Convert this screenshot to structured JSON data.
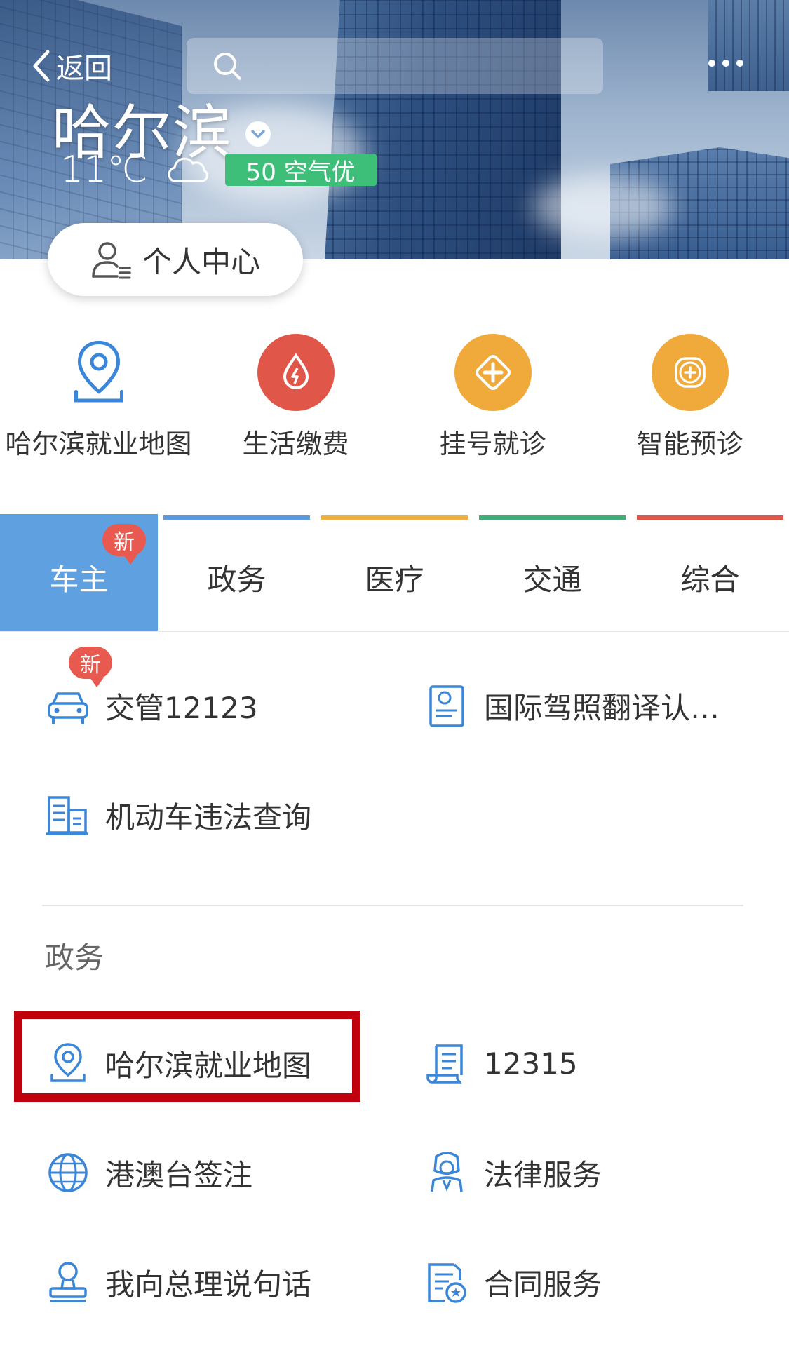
{
  "header": {
    "back_label": "返回",
    "city": "哈尔滨",
    "temperature": "11℃",
    "weather": "cloudy",
    "aqi": "50 空气优",
    "personal_center": "个人中心"
  },
  "quick_links": [
    {
      "label": "哈尔滨就业地图",
      "icon": "location-pin-icon"
    },
    {
      "label": "生活缴费",
      "icon": "utility-payment-icon"
    },
    {
      "label": "挂号就诊",
      "icon": "medical-registration-icon"
    },
    {
      "label": "智能预诊",
      "icon": "smart-diagnosis-icon"
    }
  ],
  "tabs": [
    {
      "label": "车主",
      "badge": "新",
      "active": true,
      "color": "#5fa0e1"
    },
    {
      "label": "政务",
      "color": "#5a9be0"
    },
    {
      "label": "医疗",
      "color": "#f0b03d"
    },
    {
      "label": "交通",
      "color": "#3fae78"
    },
    {
      "label": "综合",
      "color": "#e0574a"
    }
  ],
  "car_owner_services": [
    {
      "label": "交管12123",
      "badge": "新",
      "icon": "car-icon"
    },
    {
      "label": "国际驾照翻译认…",
      "icon": "license-document-icon"
    },
    {
      "label": "机动车违法查询",
      "icon": "building-records-icon"
    }
  ],
  "government_section": {
    "title": "政务",
    "services": [
      {
        "label": "哈尔滨就业地图",
        "icon": "location-pin-icon",
        "highlighted": true
      },
      {
        "label": "12315",
        "icon": "scroll-icon"
      },
      {
        "label": "港澳台签注",
        "icon": "globe-icon"
      },
      {
        "label": "法律服务",
        "icon": "judge-icon"
      },
      {
        "label": "我向总理说句话",
        "icon": "stamp-icon"
      },
      {
        "label": "合同服务",
        "icon": "contract-icon"
      }
    ]
  },
  "colors": {
    "accent_blue": "#5fa0e1",
    "icon_blue": "#3a86d8",
    "aqi_green": "#3dbf7a",
    "badge_red": "#e85a4f",
    "highlight_red": "#c1000d"
  }
}
